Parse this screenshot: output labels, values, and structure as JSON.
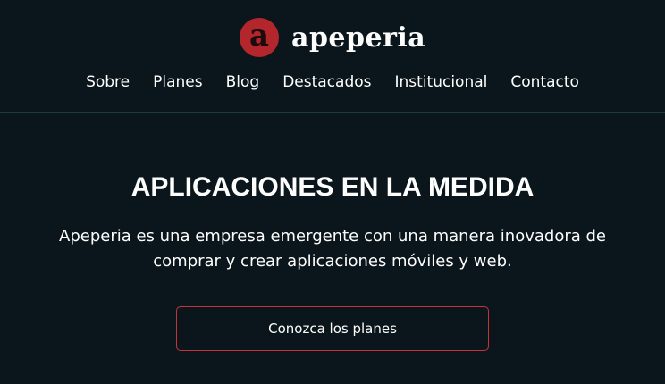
{
  "header": {
    "logo_letter": "a",
    "brand_name": "apeperia",
    "nav": [
      {
        "label": "Sobre"
      },
      {
        "label": "Planes"
      },
      {
        "label": "Blog"
      },
      {
        "label": "Destacados"
      },
      {
        "label": "Institucional"
      },
      {
        "label": "Contacto"
      }
    ]
  },
  "hero": {
    "title": "APLICACIONES EN LA MEDIDA",
    "description": "Apeperia es una empresa emergente con una manera inovadora de comprar y crear aplicaciones móviles y web.",
    "cta_label": "Conozca los planes"
  },
  "colors": {
    "background": "#0b161c",
    "accent": "#b3262b",
    "button_border": "#c1363a",
    "divider": "#1e3a40"
  },
  "icons": {
    "logo": "apeperia-logo-icon"
  }
}
